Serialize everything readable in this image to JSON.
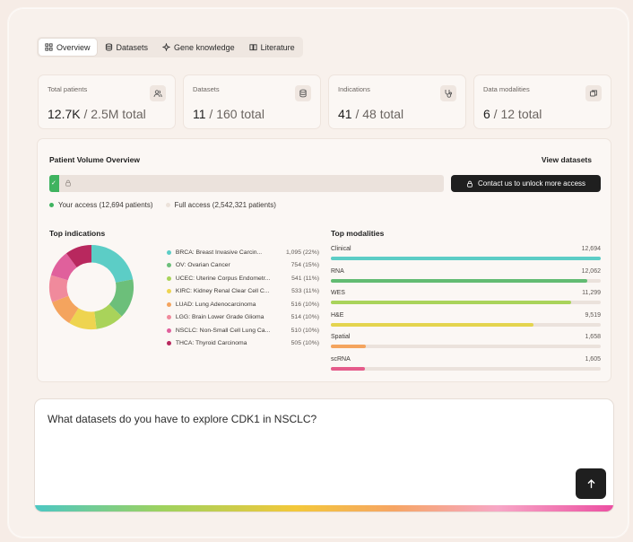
{
  "tabs": [
    {
      "label": "Overview",
      "icon": "grid-icon",
      "active": true
    },
    {
      "label": "Datasets",
      "icon": "database-icon",
      "active": false
    },
    {
      "label": "Gene knowledge",
      "icon": "sparkle-icon",
      "active": false
    },
    {
      "label": "Literature",
      "icon": "book-icon",
      "active": false
    }
  ],
  "stats": [
    {
      "label": "Total patients",
      "value": "12.7K",
      "total": " / 2.5M total",
      "icon": "users-icon"
    },
    {
      "label": "Datasets",
      "value": "11",
      "total": " / 160 total",
      "icon": "database-icon"
    },
    {
      "label": "Indications",
      "value": "41",
      "total": " / 48 total",
      "icon": "stethoscope-icon"
    },
    {
      "label": "Data modalities",
      "value": "6",
      "total": " / 12 total",
      "icon": "layers-icon"
    }
  ],
  "volume": {
    "title": "Patient Volume Overview",
    "view_link": "View datasets",
    "fill_marker": "✓",
    "access_fraction": 0.005,
    "contact_label": "Contact us to unlock more access",
    "your_access": "Your access (12,694 patients)",
    "full_access": "Full access (2,542,321 patients)",
    "colors": {
      "your": "#3fb35f",
      "full": "#ece2da"
    }
  },
  "indications": {
    "title": "Top indications",
    "items": [
      {
        "name": "BRCA: Breast Invasive Carcin...",
        "count": "1,095 (22%)",
        "value": 1095,
        "color": "#5ccdc6"
      },
      {
        "name": "OV: Ovarian Cancer",
        "count": "754 (15%)",
        "value": 754,
        "color": "#6cbf7a"
      },
      {
        "name": "UCEC: Uterine Corpus Endometr...",
        "count": "541 (11%)",
        "value": 541,
        "color": "#a9d35a"
      },
      {
        "name": "KIRC: Kidney Renal Clear Cell C...",
        "count": "533 (11%)",
        "value": 533,
        "color": "#eed450"
      },
      {
        "name": "LUAD: Lung Adenocarcinoma",
        "count": "516 (10%)",
        "value": 516,
        "color": "#f4a45e"
      },
      {
        "name": "LGG: Brain Lower Grade Glioma",
        "count": "514 (10%)",
        "value": 514,
        "color": "#f08a9c"
      },
      {
        "name": "NSCLC: Non-Small Cell Lung Ca...",
        "count": "510 (10%)",
        "value": 510,
        "color": "#e0609c"
      },
      {
        "name": "THCA: Thyroid Carcinoma",
        "count": "505 (10%)",
        "value": 505,
        "color": "#b8285e"
      }
    ]
  },
  "modalities": {
    "title": "Top modalities",
    "max": 12694,
    "items": [
      {
        "name": "Clinical",
        "value_label": "12,694",
        "value": 12694,
        "color": "#5ccdc6"
      },
      {
        "name": "RNA",
        "value_label": "12,062",
        "value": 12062,
        "color": "#62bb72"
      },
      {
        "name": "WES",
        "value_label": "11,299",
        "value": 11299,
        "color": "#a9d35a"
      },
      {
        "name": "H&E",
        "value_label": "9,519",
        "value": 9519,
        "color": "#e4d44e"
      },
      {
        "name": "Spatial",
        "value_label": "1,658",
        "value": 1658,
        "color": "#f4a45e"
      },
      {
        "name": "scRNA",
        "value_label": "1,605",
        "value": 1605,
        "color": "#e55b8a"
      }
    ]
  },
  "chat": {
    "prompt": "What datasets do you have to explore CDK1 in NSCLC?",
    "send_icon": "arrow-up-icon"
  }
}
